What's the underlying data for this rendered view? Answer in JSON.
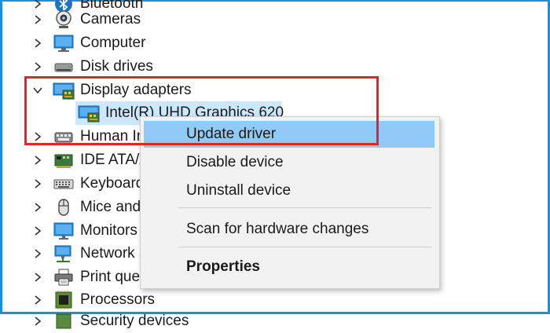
{
  "tree": {
    "items": [
      {
        "label": "Bluetooth",
        "icon": "bluetooth-icon",
        "expanded": false
      },
      {
        "label": "Cameras",
        "icon": "camera-icon",
        "expanded": false
      },
      {
        "label": "Computer",
        "icon": "computer-icon",
        "expanded": false
      },
      {
        "label": "Disk drives",
        "icon": "disk-drive-icon",
        "expanded": false
      },
      {
        "label": "Display adapters",
        "icon": "display-adapter-icon",
        "expanded": true,
        "children": [
          {
            "label": "Intel(R) UHD Graphics 620",
            "icon": "display-adapter-icon",
            "selected": true
          }
        ]
      },
      {
        "label": "Human Interface Devices",
        "icon": "hid-icon",
        "expanded": false
      },
      {
        "label": "IDE ATA/ATAPI controllers",
        "icon": "ide-controller-icon",
        "expanded": false
      },
      {
        "label": "Keyboards",
        "icon": "keyboard-icon",
        "expanded": false
      },
      {
        "label": "Mice and other pointing devices",
        "icon": "mouse-icon",
        "expanded": false
      },
      {
        "label": "Monitors",
        "icon": "monitor-icon",
        "expanded": false
      },
      {
        "label": "Network adapters",
        "icon": "network-icon",
        "expanded": false
      },
      {
        "label": "Print queues",
        "icon": "printer-icon",
        "expanded": false
      },
      {
        "label": "Processors",
        "icon": "processor-icon",
        "expanded": false
      },
      {
        "label": "Security devices",
        "icon": "security-device-icon",
        "expanded": false
      }
    ]
  },
  "context_menu": {
    "items": [
      {
        "label": "Update driver",
        "highlighted": true
      },
      {
        "label": "Disable device"
      },
      {
        "label": "Uninstall device"
      },
      {
        "label": "Scan for hardware changes"
      },
      {
        "label": "Properties",
        "bold": true
      }
    ]
  },
  "colors": {
    "frame": "#1e8fd6",
    "highlight_box": "#e2232c",
    "selection": "#cce8ff",
    "menu_hover": "#91c9f7",
    "menu_background": "#f2f2f2"
  }
}
